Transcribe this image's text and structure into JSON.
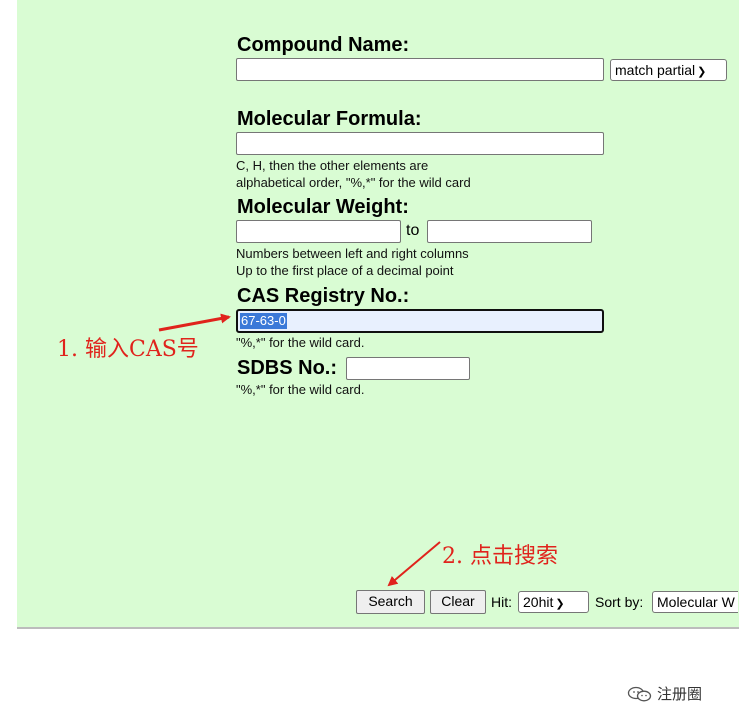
{
  "form": {
    "compound_name": {
      "label": "Compound Name:",
      "value": "",
      "match_select": "match partial"
    },
    "molecular_formula": {
      "label": "Molecular Formula:",
      "value": "",
      "note_line1": "C, H, then the other elements are",
      "note_line2": "alphabetical order, \"%,*\" for the wild card"
    },
    "molecular_weight": {
      "label": "Molecular Weight:",
      "from_value": "",
      "to_label": "to",
      "to_value": "",
      "note_line1": "Numbers between left and right columns",
      "note_line2": "Up to the first place of a decimal point"
    },
    "cas_registry": {
      "label": "CAS Registry No.:",
      "value": "67-63-0",
      "note": "\"%,*\" for the wild card."
    },
    "sdbs": {
      "label": "SDBS No.:",
      "value": "",
      "note": "\"%,*\" for the wild card."
    }
  },
  "actions": {
    "search_label": "Search",
    "clear_label": "Clear",
    "hit_label": "Hit:",
    "hit_value": "20hit",
    "sort_label": "Sort by:",
    "sort_value": "Molecular W"
  },
  "annotations": {
    "step1": "1. 输入CAS号",
    "step2": "2. 点击搜索",
    "color": "#e0231c"
  },
  "watermark": {
    "text": "注册圈",
    "icon": "wechat-icon"
  },
  "colors": {
    "panel_background": "#d9fcd3",
    "selection": "#3b79d8"
  }
}
